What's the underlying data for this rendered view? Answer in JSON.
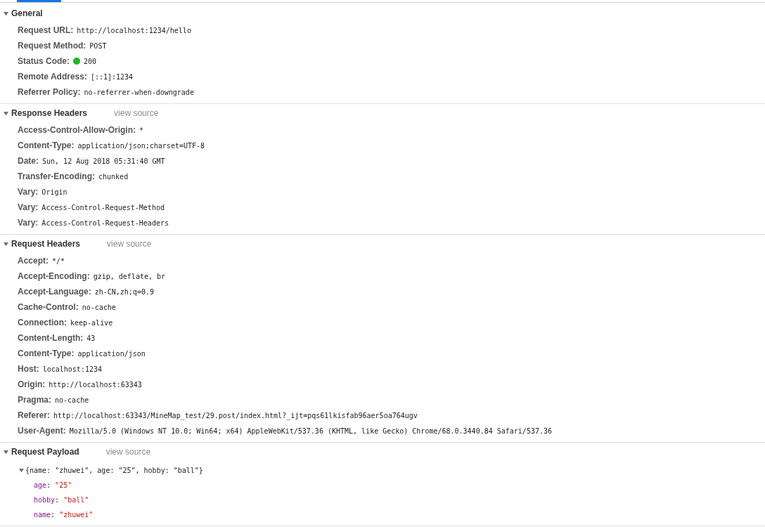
{
  "sections": [
    {
      "title": "General",
      "expanded": true,
      "rows": [
        {
          "name": "Request URL:",
          "value": "http://localhost:1234/hello"
        },
        {
          "name": "Request Method:",
          "value": "POST"
        },
        {
          "name": "Status Code:",
          "value": "200",
          "color": "#22b422"
        },
        {
          "name": "Remote Address:",
          "value": "[::1]:1234"
        },
        {
          "name": "Referrer Policy:",
          "value": "no-referrer-when-downgrade"
        }
      ]
    },
    {
      "title": "Response Headers",
      "link": "view source",
      "expanded": true,
      "rows": [
        {
          "name": "Access-Control-Allow-Origin:",
          "value": "*"
        },
        {
          "name": "Content-Type:",
          "value": "application/json;charset=UTF-8"
        },
        {
          "name": "Date:",
          "value": "Sun, 12 Aug 2018 05:31:40 GMT"
        },
        {
          "name": "Transfer-Encoding:",
          "value": "chunked"
        },
        {
          "name": "Vary:",
          "value": "Origin"
        },
        {
          "name": "Vary:",
          "value": "Access-Control-Request-Method"
        },
        {
          "name": "Vary:",
          "value": "Access-Control-Request-Headers"
        }
      ]
    },
    {
      "title": "Request Headers",
      "link": "view source",
      "expanded": true,
      "rows": [
        {
          "name": "Accept:",
          "value": "*/*"
        },
        {
          "name": "Accept-Encoding:",
          "value": "gzip, deflate, br"
        },
        {
          "name": "Accept-Language:",
          "value": "zh-CN,zh;q=0.9"
        },
        {
          "name": "Cache-Control:",
          "value": "no-cache"
        },
        {
          "name": "Connection:",
          "value": "keep-alive"
        },
        {
          "name": "Content-Length:",
          "value": "43"
        },
        {
          "name": "Content-Type:",
          "value": "application/json"
        },
        {
          "name": "Host:",
          "value": "localhost:1234"
        },
        {
          "name": "Origin:",
          "value": "http://localhost:63343"
        },
        {
          "name": "Pragma:",
          "value": "no-cache"
        },
        {
          "name": "Referer:",
          "value": "http://localhost:63343/MineMap_test/29.post/index.html?_ijt=pqs61lkisfab96aer5oa764ugv"
        },
        {
          "name": "User-Agent:",
          "value": "Mozilla/5.0 (Windows NT 10.0; Win64; x64) AppleWebKit/537.36 (KHTML, like Gecko) Chrome/68.0.3440.84 Safari/537.36"
        }
      ]
    },
    {
      "title": "Request Payload",
      "link": "view source",
      "expanded": true,
      "payload": {
        "summary": "{name: \"zhuwei\", age: \"25\", hobby: \"ball\"}",
        "expanded": true,
        "props": [
          {
            "key": "age",
            "sep": ": ",
            "value": "\"25\""
          },
          {
            "key": "hobby",
            "sep": ": ",
            "value": "\"ball\""
          },
          {
            "key": "name",
            "sep": ": ",
            "value": "\"zhuwei\""
          }
        ]
      }
    }
  ]
}
